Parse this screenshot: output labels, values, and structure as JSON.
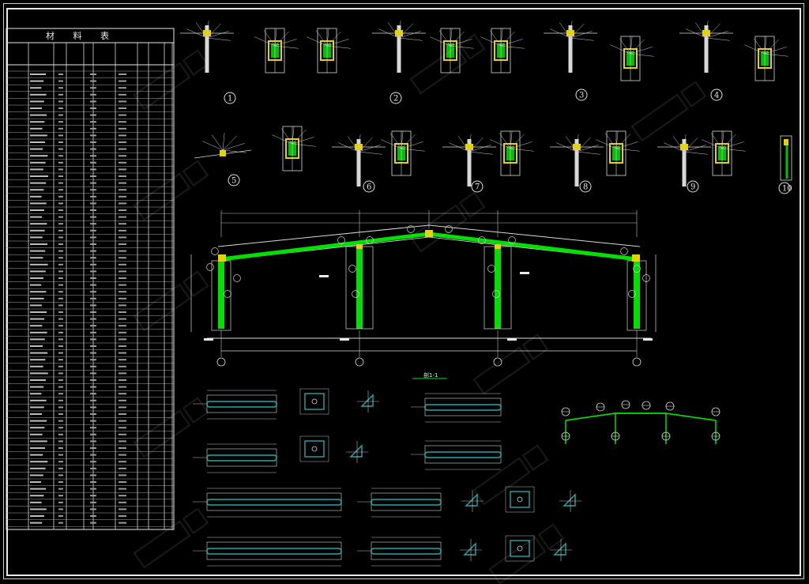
{
  "drawing": {
    "material_table": {
      "title": "材 料 表"
    },
    "detail_markers": [
      "1",
      "2",
      "3",
      "4",
      "5",
      "6",
      "7",
      "8",
      "9",
      "10"
    ],
    "center_label": "剖1-1",
    "colors": {
      "background": "#000000",
      "frame": "#e8e8e8",
      "member_green": "#00e000",
      "plate_yellow": "#e6d200",
      "plate_cyan": "#2aa6a6",
      "line_white": "#d8d8d8"
    }
  }
}
